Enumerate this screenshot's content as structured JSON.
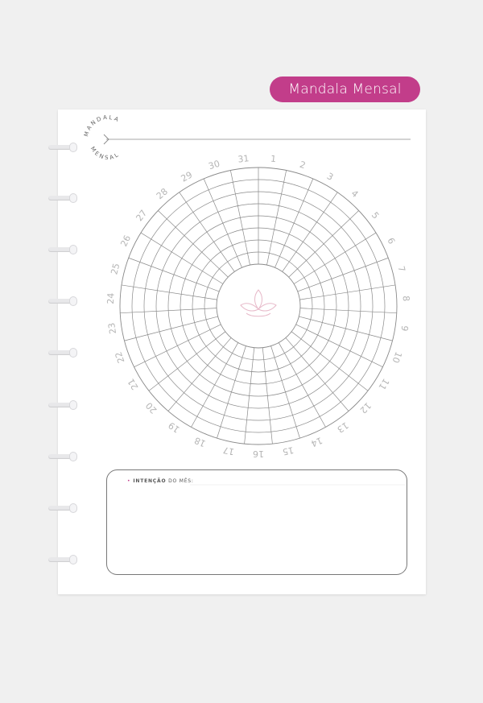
{
  "header": {
    "title": "Mandala Mensal"
  },
  "logo": {
    "top_text": "MANDALA",
    "bottom_text": "MENSAL"
  },
  "mandala": {
    "days": [
      "1",
      "2",
      "3",
      "4",
      "5",
      "6",
      "7",
      "8",
      "9",
      "10",
      "11",
      "12",
      "13",
      "14",
      "15",
      "16",
      "17",
      "18",
      "19",
      "20",
      "21",
      "22",
      "23",
      "24",
      "25",
      "26",
      "27",
      "28",
      "29",
      "30",
      "31"
    ],
    "rings": 8,
    "center_icon": "lotus-icon"
  },
  "intention": {
    "bullet": "•",
    "label_bold": "INTENÇÃO",
    "label_rest": " DO MÊS:"
  },
  "colors": {
    "accent": "#c23d8a",
    "grid": "#8a8a8a",
    "numbers": "#b5b5b5",
    "lotus": "#e7b9c9"
  }
}
